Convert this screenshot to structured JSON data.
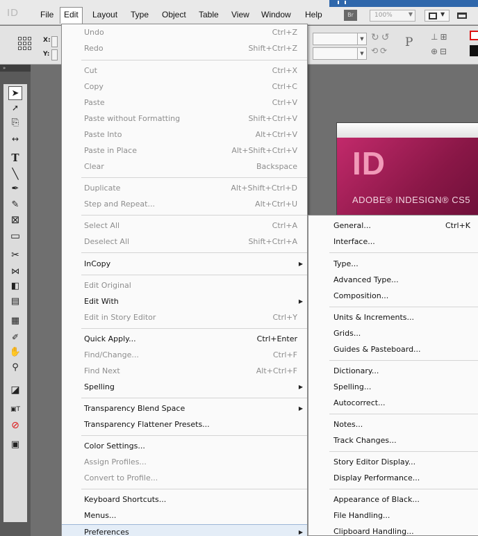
{
  "menubar": {
    "app_logo": "ID",
    "items": [
      "File",
      "Edit",
      "Layout",
      "Type",
      "Object",
      "Table",
      "View",
      "Window",
      "Help"
    ],
    "active": "Edit",
    "bridge_badge": "Br",
    "zoom": "100%"
  },
  "control_panel": {
    "x_label": "X:",
    "y_label": "Y:"
  },
  "splash": {
    "logo": "ID",
    "product_name": "ADOBE® INDESIGN® CS5"
  },
  "edit_menu": {
    "items": [
      {
        "label": "Undo",
        "shortcut": "Ctrl+Z",
        "enabled": false
      },
      {
        "label": "Redo",
        "shortcut": "Shift+Ctrl+Z",
        "enabled": false
      },
      {
        "label": "Cut",
        "shortcut": "Ctrl+X",
        "enabled": false
      },
      {
        "label": "Copy",
        "shortcut": "Ctrl+C",
        "enabled": false
      },
      {
        "label": "Paste",
        "shortcut": "Ctrl+V",
        "enabled": false
      },
      {
        "label": "Paste without Formatting",
        "shortcut": "Shift+Ctrl+V",
        "enabled": false
      },
      {
        "label": "Paste Into",
        "shortcut": "Alt+Ctrl+V",
        "enabled": false
      },
      {
        "label": "Paste in Place",
        "shortcut": "Alt+Shift+Ctrl+V",
        "enabled": false
      },
      {
        "label": "Clear",
        "shortcut": "Backspace",
        "enabled": false
      },
      {
        "label": "Duplicate",
        "shortcut": "Alt+Shift+Ctrl+D",
        "enabled": false
      },
      {
        "label": "Step and Repeat...",
        "shortcut": "Alt+Ctrl+U",
        "enabled": false
      },
      {
        "label": "Select All",
        "shortcut": "Ctrl+A",
        "enabled": false
      },
      {
        "label": "Deselect All",
        "shortcut": "Shift+Ctrl+A",
        "enabled": false
      },
      {
        "label": "InCopy",
        "submenu": true,
        "enabled": true
      },
      {
        "label": "Edit Original",
        "enabled": false
      },
      {
        "label": "Edit With",
        "submenu": true,
        "enabled": true
      },
      {
        "label": "Edit in Story Editor",
        "shortcut": "Ctrl+Y",
        "enabled": false
      },
      {
        "label": "Quick Apply...",
        "shortcut": "Ctrl+Enter",
        "enabled": true
      },
      {
        "label": "Find/Change...",
        "shortcut": "Ctrl+F",
        "enabled": false
      },
      {
        "label": "Find Next",
        "shortcut": "Alt+Ctrl+F",
        "enabled": false
      },
      {
        "label": "Spelling",
        "submenu": true,
        "enabled": true
      },
      {
        "label": "Transparency Blend Space",
        "submenu": true,
        "enabled": true
      },
      {
        "label": "Transparency Flattener Presets...",
        "enabled": true
      },
      {
        "label": "Color Settings...",
        "enabled": true
      },
      {
        "label": "Assign Profiles...",
        "enabled": false
      },
      {
        "label": "Convert to Profile...",
        "enabled": false
      },
      {
        "label": "Keyboard Shortcuts...",
        "enabled": true
      },
      {
        "label": "Menus...",
        "enabled": true
      },
      {
        "label": "Preferences",
        "submenu": true,
        "enabled": true,
        "highlighted": true
      }
    ]
  },
  "preferences_menu": {
    "items": [
      {
        "label": "General...",
        "shortcut": "Ctrl+K"
      },
      {
        "label": "Interface..."
      },
      {
        "label": "Type..."
      },
      {
        "label": "Advanced Type..."
      },
      {
        "label": "Composition..."
      },
      {
        "label": "Units & Increments..."
      },
      {
        "label": "Grids..."
      },
      {
        "label": "Guides & Pasteboard..."
      },
      {
        "label": "Dictionary..."
      },
      {
        "label": "Spelling..."
      },
      {
        "label": "Autocorrect..."
      },
      {
        "label": "Notes..."
      },
      {
        "label": "Track Changes..."
      },
      {
        "label": "Story Editor Display..."
      },
      {
        "label": "Display Performance..."
      },
      {
        "label": "Appearance of Black..."
      },
      {
        "label": "File Handling..."
      },
      {
        "label": "Clipboard Handling..."
      }
    ]
  },
  "tools": [
    "selection-tool",
    "direct-selection-tool",
    "page-tool",
    "gap-tool",
    "type-tool",
    "line-tool",
    "pen-tool",
    "pencil-tool",
    "rectangle-frame-tool",
    "rectangle-tool",
    "scissors-tool",
    "free-transform-tool",
    "gradient-swatch-tool",
    "gradient-feather-tool",
    "note-tool",
    "eyedropper-tool",
    "hand-tool",
    "zoom-tool",
    "fill-stroke-swatches",
    "formatting-affects-container",
    "apply-none",
    "screen-mode"
  ],
  "colors": {
    "menu_highlight": "#e4edf7",
    "disabled_text": "#8d8d8d",
    "splash_magenta": "#a3205a",
    "titlebar_blue": "#2f67ab"
  }
}
